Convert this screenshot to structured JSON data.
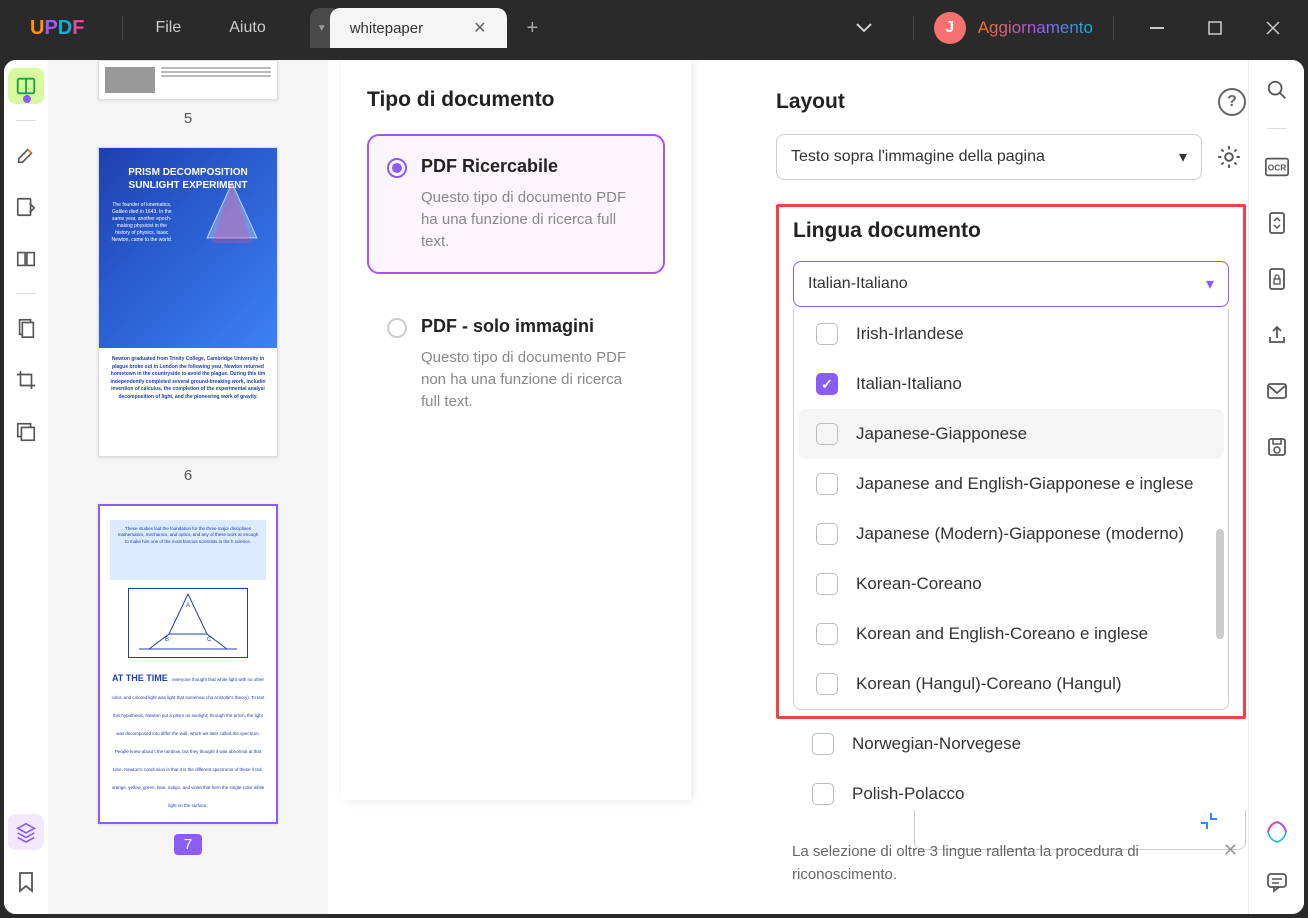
{
  "titlebar": {
    "menu": {
      "file": "File",
      "help": "Aiuto"
    },
    "tab": {
      "title": "whitepaper"
    },
    "avatar_letter": "J",
    "upgrade": "Aggiornamento"
  },
  "thumbnails": {
    "p5": "5",
    "p6": "6",
    "p7": "7",
    "p6_title": "PRISM DECOMPOSITION SUNLIGHT EXPERIMENT",
    "p6_sub": "The founder of kinematics, Galileo died in 1643. In the same year, another epoch-making physicist in the history of physics, Isaac Newton, came to the world.",
    "p6_body": "Newton graduated from Trinity College, Cambridge University in plague broke out in London the following year, Newton returned hometown in the countryside to avoid the plague. During this tim independently completed several ground-breaking work, includin invention of calculus, the completion of the experimental analysi decomposition of light, and the pioneering work of gravity.",
    "p7_top": "These studies laid the foundation for the three major disciplines mathematics, mechanics, and optics, and any of these work ar enough to make him one of the most famous scientists in the h science.",
    "p7_heading": "AT THE TIME",
    "p7_body": "everyone thought that white light with no other color, and colored light was light that somehow cha Aristotle's theory). To test this hypothesis, Newton put a prism un sunlight; through the prism, the light was decomposed into differ the wall, which we later called the spectrum. People knew about t the rainbow, but they thought it was abnormal at that time. Newton's conclusion is that it is the different spectrums of these li red, orange, yellow, green, blue, indigo, and violet that form the single-color white light on the surface."
  },
  "leftPanel": {
    "heading": "Tipo di documento",
    "opt1_title": "PDF Ricercabile",
    "opt1_desc": "Questo tipo di documento PDF ha una funzione di ricerca full text.",
    "opt2_title": "PDF - solo immagini",
    "opt2_desc": "Questo tipo di documento PDF non ha una funzione di ricerca full text."
  },
  "rightPanel": {
    "layout_title": "Layout",
    "layout_value": "Testo sopra l'immagine della pagina",
    "lang_title": "Lingua documento",
    "lang_selected": "Italian-Italiano",
    "languages": [
      {
        "label": "Irish-Irlandese",
        "checked": false
      },
      {
        "label": "Italian-Italiano",
        "checked": true
      },
      {
        "label": "Japanese-Giapponese",
        "checked": false
      },
      {
        "label": "Japanese and English-Giapponese e inglese",
        "checked": false
      },
      {
        "label": "Japanese (Modern)-Giapponese (moderno)",
        "checked": false
      },
      {
        "label": "Korean-Coreano",
        "checked": false
      },
      {
        "label": "Korean and English-Coreano e inglese",
        "checked": false
      },
      {
        "label": "Korean (Hangul)-Coreano (Hangul)",
        "checked": false
      }
    ],
    "extra_languages": [
      {
        "label": "Norwegian-Norvegese",
        "checked": false
      },
      {
        "label": "Polish-Polacco",
        "checked": false
      }
    ],
    "warning": "La selezione di oltre 3 lingue rallenta la procedura di riconoscimento."
  }
}
